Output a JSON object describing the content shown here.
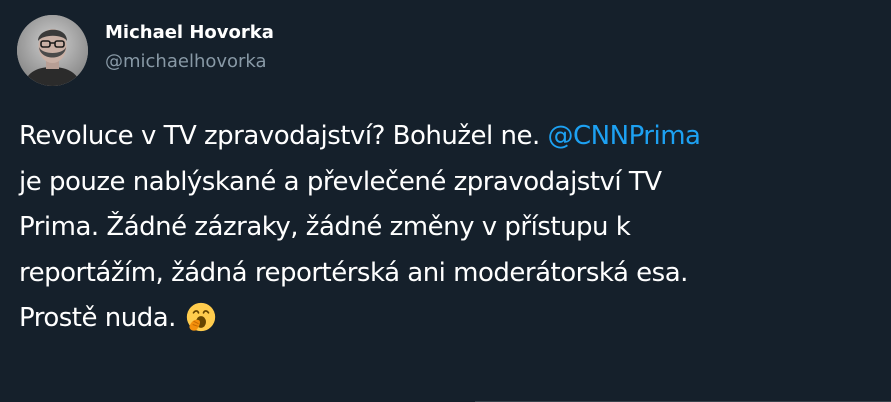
{
  "author": {
    "display_name": "Michael Hovorka",
    "handle": "@michaelhovorka",
    "avatar_icon": "user-avatar-photo"
  },
  "tweet": {
    "line1_text": "Revoluce v TV zpravodajství? Bohužel ne. ",
    "line1_mention": "@CNNPrima",
    "line2": "je pouze nablýskané a převlečené zpravodajství TV",
    "line3": "Prima. Žádné zázraky, žádné změny v přístupu k",
    "line4": "reportážím, žádná reportérská ani moderátorská esa.",
    "line5_text": "Prostě nuda. ",
    "emoji_icon": "yawning-face-emoji"
  },
  "colors": {
    "background": "#15202b",
    "text": "#ffffff",
    "secondary_text": "#8899a6",
    "link": "#1da1f2"
  }
}
